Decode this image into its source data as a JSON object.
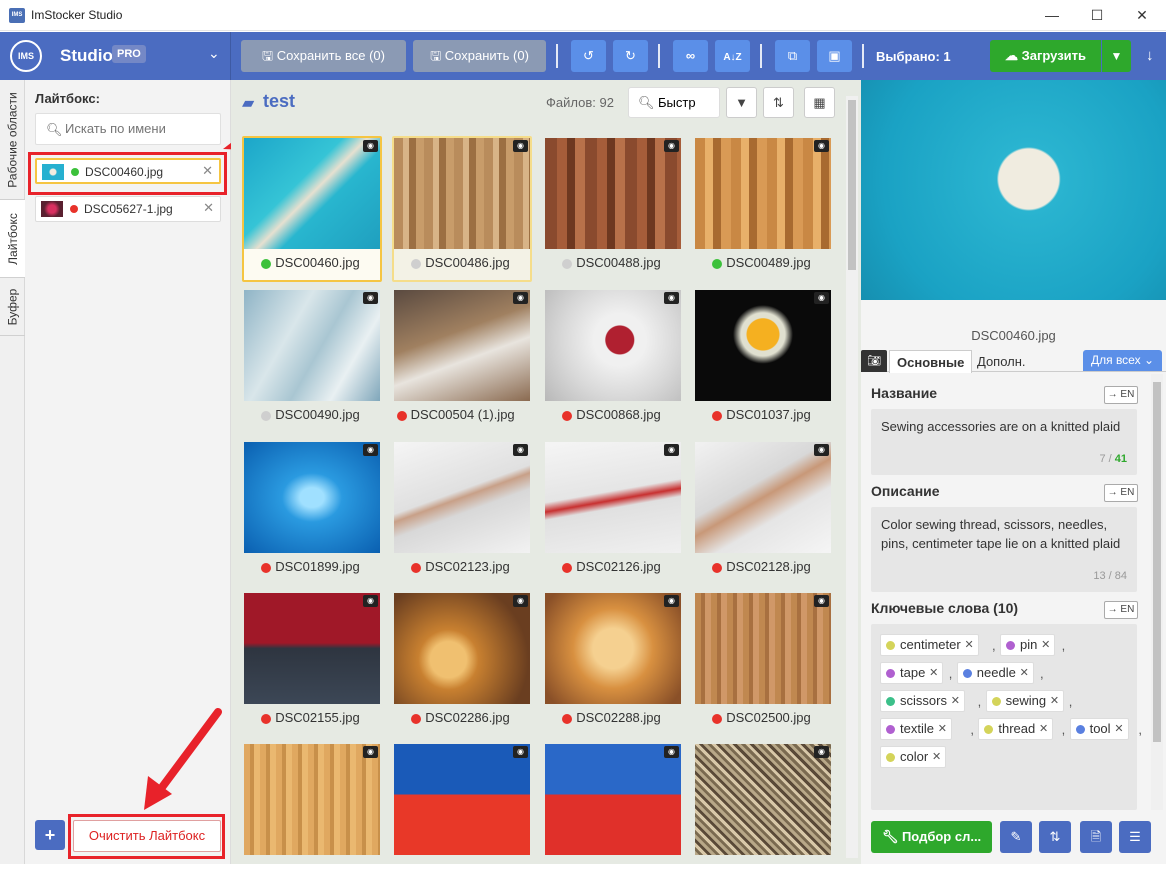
{
  "titlebar": {
    "app_icon": "IMS",
    "title": "ImStocker Studio",
    "minimize": "—",
    "maximize": "☐",
    "close": "✕"
  },
  "studio": {
    "logo": "IMS",
    "label": "Studio",
    "pro": "PRO"
  },
  "toolbar": {
    "save_all": "Сохранить все (0)",
    "save": "Сохранить (0)",
    "selected": "Выбрано: 1",
    "upload": "Загрузить"
  },
  "vtabs": {
    "workspaces": "Рабочие области",
    "lightbox": "Лайтбокс",
    "buffer": "Буфер"
  },
  "lightbox": {
    "title": "Лайтбокс:",
    "search_placeholder": "Искать по имени",
    "items": [
      {
        "name": "DSC00460.jpg",
        "status": "#3cc13b",
        "selected": true
      },
      {
        "name": "DSC05627-1.jpg",
        "status": "#e8322a",
        "selected": false
      }
    ],
    "add_label": "+",
    "clear_label": "Очистить Лайтбокс"
  },
  "grid": {
    "folder": "test",
    "files_count": "Файлов: 92",
    "search_value": "Быстр",
    "tiles": [
      {
        "name": "DSC00460.jpg",
        "status": "#3cc13b",
        "bg": "linear-gradient(135deg,#1ca6c9,#35c4d6 40%,#e6e0d0 50%,#28b6cf 60%,#1f9fbf)"
      },
      {
        "name": "DSC00486.jpg",
        "status": "#cfcfcf",
        "bg": "repeating-linear-gradient(90deg,#b98c5c 0 9px,#d8b487 9px 15px,#9c6f42 15px 22px,#c89c6a 22px 30px)"
      },
      {
        "name": "DSC00488.jpg",
        "status": "#cfcfcf",
        "bg": "repeating-linear-gradient(90deg,#8a4a2e 0 12px,#a65d3a 12px 22px,#6e3820 22px 30px,#b8714a 30px 40px)"
      },
      {
        "name": "DSC00489.jpg",
        "status": "#3cc13b",
        "bg": "repeating-linear-gradient(90deg,#c98844 0 10px,#e8b06a 10px 18px,#a86a30 18px 26px,#d99a55 26px 36px)"
      },
      {
        "name": "DSC00490.jpg",
        "status": "#cfcfcf",
        "bg": "linear-gradient(120deg,#8fb4c6,#d9e6ea 35%,#a9c6d2 55%,#e9f0f2 75%,#7fa6ba)"
      },
      {
        "name": "DSC00504 (1).jpg",
        "status": "#e8322a",
        "bg": "linear-gradient(160deg,#5a4a40,#a08060 40%,#e8e4de 60%,#8a6a50)"
      },
      {
        "name": "DSC00868.jpg",
        "status": "#e8322a",
        "bg": "radial-gradient(circle at 55% 45%,#b02030 0 14px,#f0f0f0 15px 26px,#d8d8d8 60%,#b8b8b8)"
      },
      {
        "name": "DSC01037.jpg",
        "status": "#e8322a",
        "bg": "radial-gradient(ellipse at 50% 40%,#f5b020 0 16px,#e0e0d0 17px 22px,#0a0a0a 30px)"
      },
      {
        "name": "DSC01899.jpg",
        "status": "#e8322a",
        "bg": "radial-gradient(ellipse at 50% 50%,#a0e0ff 0 12px,#2a9ae0 30px,#0a5fb0)"
      },
      {
        "name": "DSC02123.jpg",
        "status": "#e8322a",
        "bg": "linear-gradient(160deg,#f5f5f5,#e0e0e0 45%,#c8a088 50%,#d8d8d8 60%,#f2f2f2)"
      },
      {
        "name": "DSC02126.jpg",
        "status": "#e8322a",
        "bg": "linear-gradient(170deg,#f5f5f5,#e5e5e5 45%,#c83030 52%,#e0e0e0 58%,#f0f0f0)"
      },
      {
        "name": "DSC02128.jpg",
        "status": "#e8322a",
        "bg": "linear-gradient(150deg,#f2f2f2,#d8d8d8 40%,#c89878 50%,#e5e5e5 65%,#f5f5f5)"
      },
      {
        "name": "DSC02155.jpg",
        "status": "#e8322a",
        "bg": "linear-gradient(180deg,#a01828 0 45%,#2e3540 50%,#3c4756 100%)"
      },
      {
        "name": "DSC02286.jpg",
        "status": "#e8322a",
        "bg": "radial-gradient(circle at 40% 60%,#f0c070 0 18px,#c88030 30px,#6a3e20 80px)"
      },
      {
        "name": "DSC02288.jpg",
        "status": "#e8322a",
        "bg": "radial-gradient(circle at 50% 50%,#f5d090 0 20px,#d89040 40px,#8a5028 80px)"
      },
      {
        "name": "DSC02500.jpg",
        "status": "#e8322a",
        "bg": "repeating-linear-gradient(90deg,#c08850 0 6px,#a87040 6px 10px,#d09868 10px 16px)"
      },
      {
        "name": "",
        "status": "",
        "bg": "repeating-linear-gradient(90deg,#e0a860 0 6px,#c8904a 6px 10px,#eab870 10px 16px)"
      },
      {
        "name": "",
        "status": "",
        "bg": "linear-gradient(180deg,#1a5ab8 0 45%,#e83828 46% 100%)"
      },
      {
        "name": "",
        "status": "",
        "bg": "linear-gradient(180deg,#2a68c8 0 45%,#e0302a 46% 100%)"
      },
      {
        "name": "",
        "status": "",
        "bg": "repeating-linear-gradient(45deg,#b8a888 0 3px,#7a6a50 3px 6px,#d8c8a8 6px 9px,#5a4a38 9px 12px)"
      }
    ]
  },
  "detail": {
    "preview_bg": "radial-gradient(circle at 55% 45%,#f0ece0 0 30px,#2ab4d0 32px,#1aa2c4 70%,#168fb0)",
    "preview_name": "DSC00460.jpg",
    "tab_main": "Основные",
    "tab_extra": "Дополн.",
    "for_all": "Для всех",
    "title_label": "Название",
    "title_value": "Sewing accessories are on a knitted plaid",
    "title_count": "7",
    "title_max": "41",
    "desc_label": "Описание",
    "desc_value": "Color sewing thread, scissors, needles, pins, centimeter tape lie on a knitted plaid",
    "desc_count": "13 / 84",
    "kw_label": "Ключевые слова (10)",
    "en": "→ EN",
    "keywords": [
      {
        "text": "centimeter",
        "color": "#d4d45a"
      },
      {
        "text": "pin",
        "color": "#b060d0"
      },
      {
        "text": "tape",
        "color": "#b060d0"
      },
      {
        "text": "needle",
        "color": "#5a80e0"
      },
      {
        "text": "scissors",
        "color": "#3cc08a"
      },
      {
        "text": "sewing",
        "color": "#d4d45a"
      },
      {
        "text": "textile",
        "color": "#b060d0"
      },
      {
        "text": "thread",
        "color": "#d4d45a"
      },
      {
        "text": "tool",
        "color": "#5a80e0"
      },
      {
        "text": "color",
        "color": "#d4d45a"
      }
    ],
    "pick_label": "Подбор сл..."
  }
}
